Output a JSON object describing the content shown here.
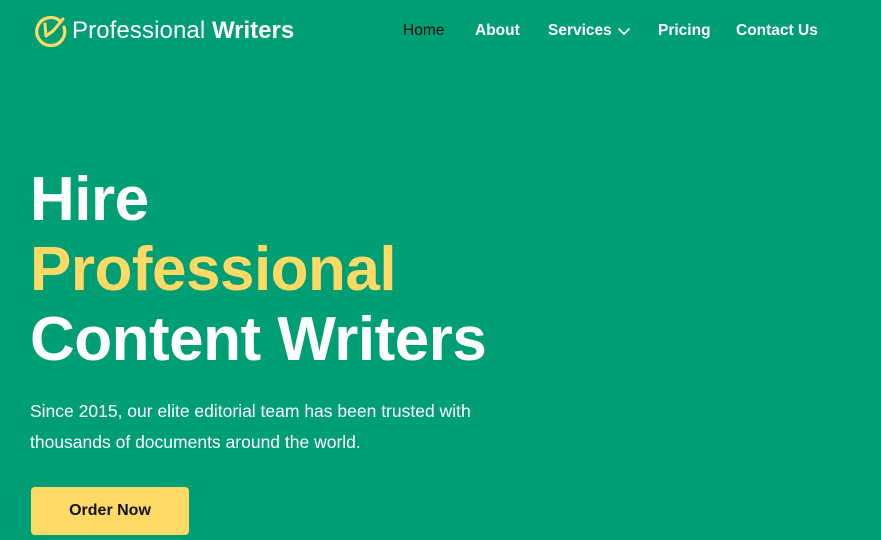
{
  "brand": {
    "name_light": "Professional",
    "name_bold": "Writers",
    "logo_icon": "pen-circle-icon",
    "accent_color": "#ffd966",
    "background_color": "#009e74"
  },
  "nav": {
    "items": [
      {
        "label": "Home",
        "active": true
      },
      {
        "label": "About",
        "active": false
      },
      {
        "label": "Services",
        "active": false,
        "icon": "chevron-down-icon"
      },
      {
        "label": "Pricing",
        "active": false
      },
      {
        "label": "Contact Us",
        "active": false
      }
    ]
  },
  "hero": {
    "title_line1": "Hire",
    "title_line2": "Professional",
    "title_line3": "Content Writers",
    "subtitle": "Since 2015, our elite editorial team has been trusted with thousands of documents around the world.",
    "cta_label": "Order Now"
  }
}
